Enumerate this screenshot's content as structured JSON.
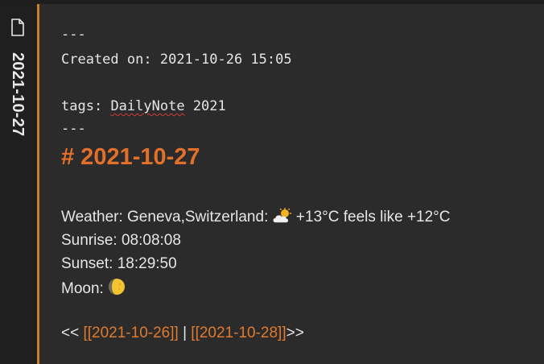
{
  "tab": {
    "title": "2021-10-27",
    "icon": "file-icon"
  },
  "frontmatter": {
    "open_delim": "---",
    "created_label": "Created on:",
    "created_value": "2021-10-26 15:05",
    "tags_label": "tags:",
    "tag_1": "DailyNote",
    "tag_2": "2021",
    "close_delim": "---"
  },
  "heading": "# 2021-10-27",
  "weather": {
    "label": "Weather:",
    "location": "Geneva,Switzerland:",
    "icon": "sun-behind-cloud-icon",
    "temp": "+13°C feels like +12°C"
  },
  "sunrise": {
    "label": "Sunrise:",
    "value": "08:08:08"
  },
  "sunset": {
    "label": "Sunset:",
    "value": "18:29:50"
  },
  "moon": {
    "label": "Moon:",
    "icon": "waning-crescent-moon-icon"
  },
  "nav": {
    "prev_arrows": "<<",
    "prev_link": "[[2021-10-26]]",
    "separator": "|",
    "next_link": "[[2021-10-28]]",
    "next_arrows": ">>"
  },
  "colors": {
    "accent": "#e2702b",
    "link": "#e07a2c",
    "rail_border": "#c9802b",
    "background": "#2b2b2b",
    "text": "#e6e6e6"
  }
}
